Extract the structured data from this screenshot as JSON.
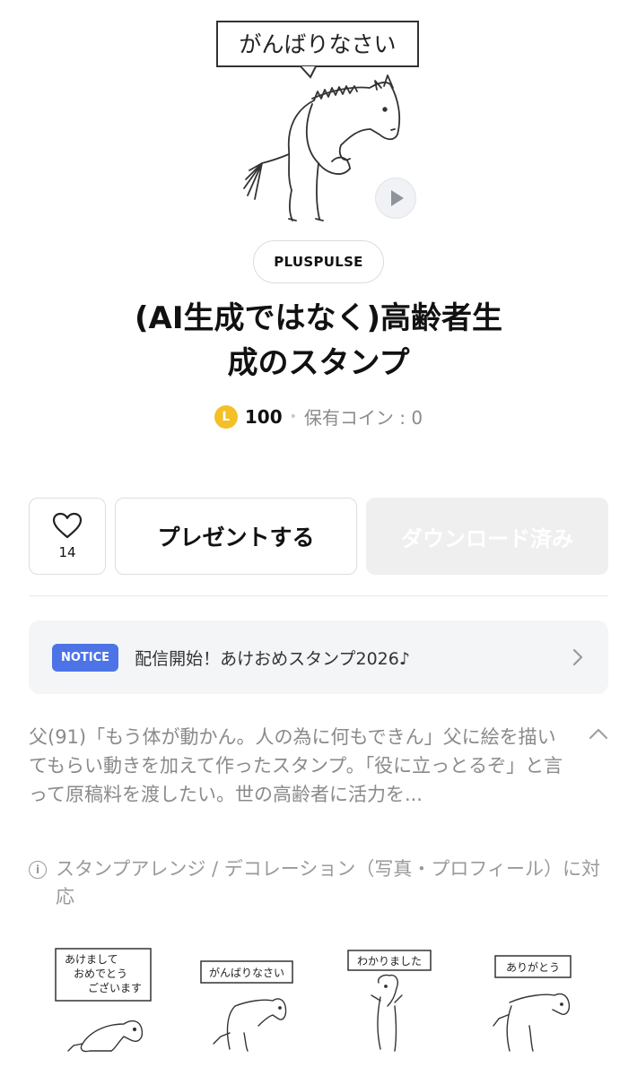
{
  "hero": {
    "speech_text": "がんばりなさい",
    "play_icon": "play-icon"
  },
  "author": "PLUSPULSE",
  "title_line1": "(AI生成ではなく)高齢者生",
  "title_line2": "成のスタンプ",
  "price": {
    "coin_letter": "L",
    "amount": "100",
    "separator": "•",
    "owned_text": "保有コイン : 0"
  },
  "actions": {
    "like_icon": "heart-icon",
    "like_count": "14",
    "present_label": "プレゼントする",
    "download_label": "ダウンロード済み"
  },
  "notice": {
    "badge": "NOTICE",
    "text": "配信開始！あけおめスタンプ2026♪"
  },
  "description": "父(91)「もう体が動かん。人の為に何もできん」父に絵を描いてもらい動きを加えて作ったスタンプ。「役に立っとるぞ」と言って原稿料を渡したい。世の高齢者に活力を...",
  "arrange_info": "スタンプアレンジ / デコレーション（写真・プロフィール）に対応",
  "stickers": [
    {
      "lines": [
        "あけまして",
        "おめでとう",
        "ございます"
      ]
    },
    {
      "lines": [
        "がんばりなさい"
      ]
    },
    {
      "lines": [
        "わかりました"
      ]
    },
    {
      "lines": [
        "ありがとう"
      ]
    }
  ],
  "colors": {
    "notice_badge": "#4d74e6",
    "coin": "#f4c027",
    "download_disabled_bg": "#efefef"
  }
}
